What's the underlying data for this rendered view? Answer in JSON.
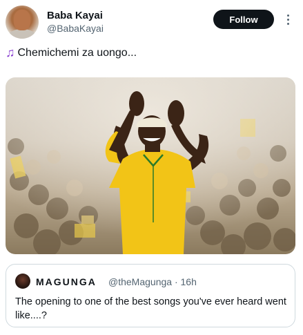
{
  "author": {
    "name": "Baba Kayai",
    "handle": "@BabaKayai"
  },
  "follow_label": "Follow",
  "tweet": {
    "icon": "music-notes-icon",
    "text": "Chemichemi za uongo..."
  },
  "quoted": {
    "name": "MAGUNGA",
    "meta": "@theMagunga · 16h",
    "text": "The opening to one of the best songs you've ever heard went like....?"
  },
  "colors": {
    "follow_bg": "#0f1419",
    "secondary_text": "#536471",
    "note_icon": "#8a3fd1",
    "shirt": "#f2c417"
  }
}
